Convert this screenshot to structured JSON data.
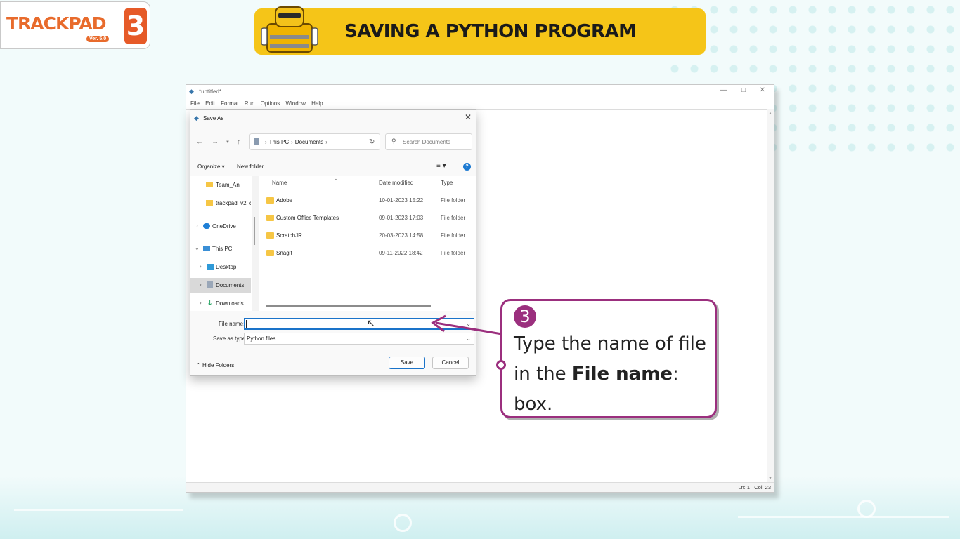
{
  "logo": {
    "text": "TRACKPAD",
    "version": "Ver. 5.0",
    "number": "3"
  },
  "banner": {
    "title": "SAVING A PYTHON PROGRAM"
  },
  "idle": {
    "title": "*untitled*",
    "menu": [
      "File",
      "Edit",
      "Format",
      "Run",
      "Options",
      "Window",
      "Help"
    ],
    "status_ln": "Ln: 1",
    "status_col": "Col: 23"
  },
  "dialog": {
    "title": "Save As",
    "address": {
      "pc": "This PC",
      "folder": "Documents"
    },
    "search_placeholder": "Search Documents",
    "toolbar": {
      "organize": "Organize ▾",
      "new_folder": "New folder"
    },
    "tree": [
      {
        "label": "Team_Ani",
        "type": "folder",
        "indent": 2
      },
      {
        "label": "trackpad_v2_cla",
        "type": "folder",
        "indent": 2
      },
      {
        "label": "OneDrive",
        "type": "cloud",
        "indent": 1
      },
      {
        "label": "This PC",
        "type": "pc",
        "indent": 1
      },
      {
        "label": "Desktop",
        "type": "desktop",
        "indent": 2
      },
      {
        "label": "Documents",
        "type": "docs",
        "indent": 2,
        "selected": true
      },
      {
        "label": "Downloads",
        "type": "download",
        "indent": 2
      }
    ],
    "columns": {
      "name": "Name",
      "date": "Date modified",
      "type": "Type"
    },
    "files": [
      {
        "name": "Adobe",
        "date": "10-01-2023 15:22",
        "type": "File folder"
      },
      {
        "name": "Custom Office Templates",
        "date": "09-01-2023 17:03",
        "type": "File folder"
      },
      {
        "name": "ScratchJR",
        "date": "20-03-2023 14:58",
        "type": "File folder"
      },
      {
        "name": "Snagit",
        "date": "09-11-2022 18:42",
        "type": "File folder"
      }
    ],
    "file_name_label": "File name:",
    "file_name_value": "",
    "save_type_label": "Save as type:",
    "save_type_value": "Python files",
    "hide_folders": "Hide Folders",
    "save_button": "Save",
    "cancel_button": "Cancel"
  },
  "callout": {
    "number": "3",
    "text_before": "Type the name of file in the ",
    "text_bold": "File name",
    "text_after": ": box."
  },
  "colors": {
    "accent": "#9b2f7e",
    "banner": "#f5c518",
    "logo": "#e86b2c"
  }
}
